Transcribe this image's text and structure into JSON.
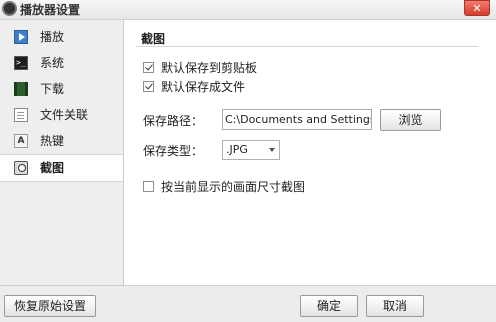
{
  "window": {
    "title": "播放器设置",
    "close_glyph": "✕"
  },
  "sidebar": {
    "items": [
      {
        "label": "播放",
        "icon": "play-icon"
      },
      {
        "label": "系统",
        "icon": "system-icon"
      },
      {
        "label": "下载",
        "icon": "download-icon"
      },
      {
        "label": "文件关联",
        "icon": "file-association-icon"
      },
      {
        "label": "热键",
        "icon": "hotkey-icon",
        "icon_text": "A"
      },
      {
        "label": "截图",
        "icon": "screenshot-icon",
        "active": true
      }
    ]
  },
  "screenshot_panel": {
    "title": "截图",
    "copy_to_clipboard": {
      "label": "默认保存到剪贴板",
      "checked": true
    },
    "save_to_file": {
      "label": "默认保存成文件",
      "checked": true
    },
    "save_path": {
      "label": "保存路径：",
      "value": "C:\\Documents and Settings\\sh"
    },
    "browse_label": "浏览",
    "save_type": {
      "label": "保存类型：",
      "value": ".JPG"
    },
    "capture_current_size": {
      "label": "按当前显示的画面尺寸截图",
      "checked": false
    }
  },
  "footer": {
    "restore_defaults_label": "恢复原始设置",
    "ok_label": "确定",
    "cancel_label": "取消"
  }
}
